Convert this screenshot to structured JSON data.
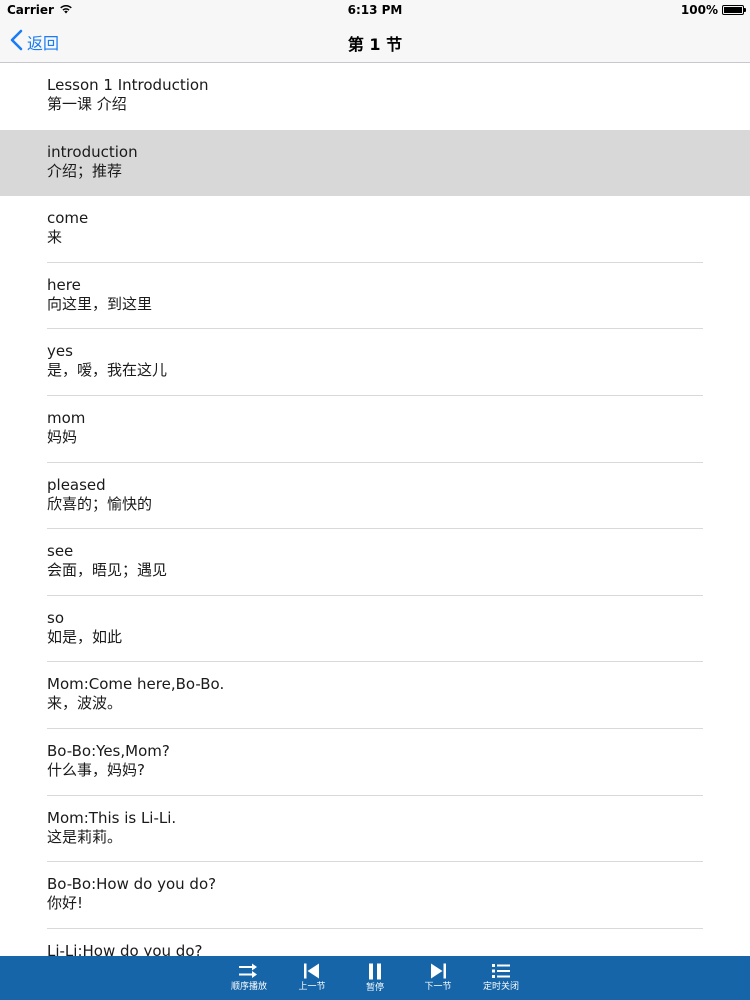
{
  "status_bar": {
    "carrier": "Carrier",
    "time": "6:13 PM",
    "battery": "100%",
    "battery_level": 1.0
  },
  "nav": {
    "back_label": "返回",
    "title": "第 1 节"
  },
  "list": {
    "selected_index": 1,
    "items": [
      {
        "en": "Lesson 1 Introduction",
        "zh": "第一课 介绍"
      },
      {
        "en": "introduction",
        "zh": "介绍；推荐"
      },
      {
        "en": "come",
        "zh": "来"
      },
      {
        "en": "here",
        "zh": "向这里，到这里"
      },
      {
        "en": "yes",
        "zh": "是，嗳，我在这儿"
      },
      {
        "en": "mom",
        "zh": "妈妈"
      },
      {
        "en": "pleased",
        "zh": "欣喜的；愉快的"
      },
      {
        "en": "see",
        "zh": "会面，晤见；遇见"
      },
      {
        "en": "so",
        "zh": "如是，如此"
      },
      {
        "en": "Mom:Come here,Bo-Bo.",
        "zh": "来，波波。"
      },
      {
        "en": "Bo-Bo:Yes,Mom?",
        "zh": "什么事，妈妈?"
      },
      {
        "en": "Mom:This is Li-Li.",
        "zh": "这是莉莉。"
      },
      {
        "en": "Bo-Bo:How do you do?",
        "zh": "你好!"
      },
      {
        "en": "Li-Li:How do you do?",
        "zh": ""
      }
    ]
  },
  "toolbar": {
    "items": [
      {
        "label": "顺序播放",
        "icon": "sequential-play-icon"
      },
      {
        "label": "上一节",
        "icon": "previous-section-icon"
      },
      {
        "label": "暂停",
        "icon": "pause-icon"
      },
      {
        "label": "下一节",
        "icon": "next-section-icon"
      },
      {
        "label": "定时关闭",
        "icon": "timer-close-list-icon"
      }
    ]
  },
  "colors": {
    "accent": "#1a7cf4",
    "toolbar_bg": "#1565a8",
    "selected_row": "#d8d8d8"
  }
}
